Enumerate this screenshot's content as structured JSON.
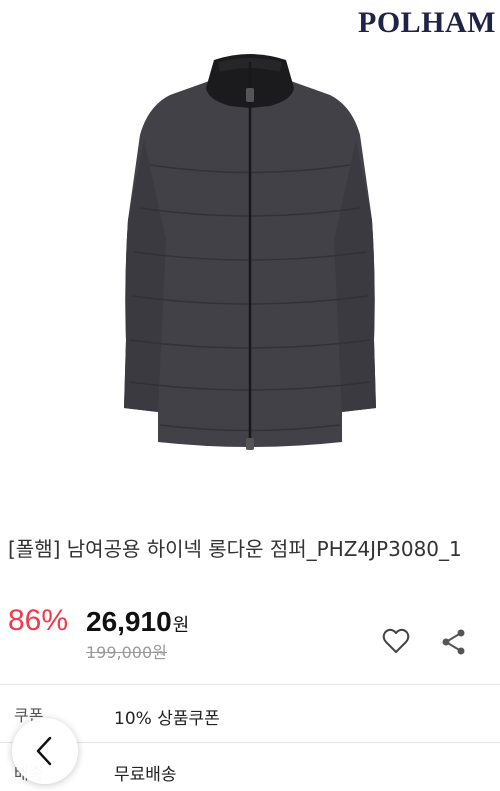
{
  "header": {
    "brand": "POLHAM"
  },
  "product": {
    "title": "[폴햄] 남여공용 하이넥 롱다운 점퍼_PHZ4JP3080_1",
    "discount": "86%",
    "sale_price": "26,910",
    "currency": "원",
    "original_price": "199,000원"
  },
  "actions": {
    "wishlist_icon": "heart-outline",
    "share_icon": "share"
  },
  "info": {
    "coupon_label": "쿠폰",
    "coupon_value": "10% 상품쿠폰",
    "shipping_label": "배송",
    "shipping_value": "무료배송"
  },
  "colors": {
    "accent": "#ef3b4c",
    "brand": "#1f2347"
  }
}
